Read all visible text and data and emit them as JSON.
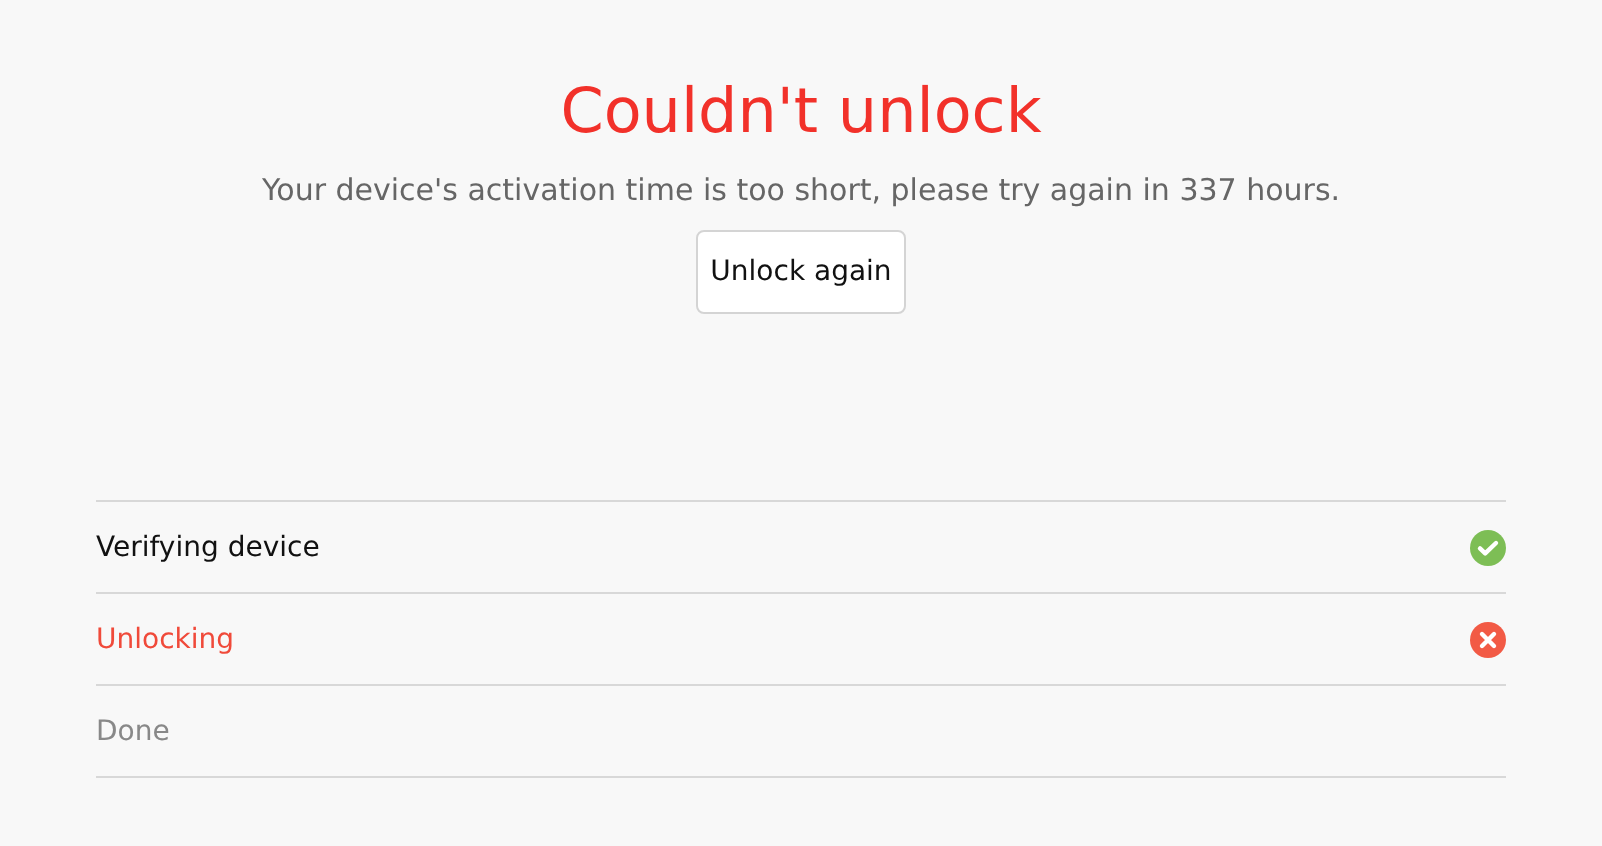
{
  "title": "Couldn't unlock",
  "message": "Your device's activation time is too short, please try again in 337 hours.",
  "button": "Unlock again",
  "steps": [
    {
      "label": "Verifying device",
      "kind": "success"
    },
    {
      "label": "Unlocking",
      "kind": "failed"
    },
    {
      "label": "Done",
      "kind": "pending"
    }
  ]
}
